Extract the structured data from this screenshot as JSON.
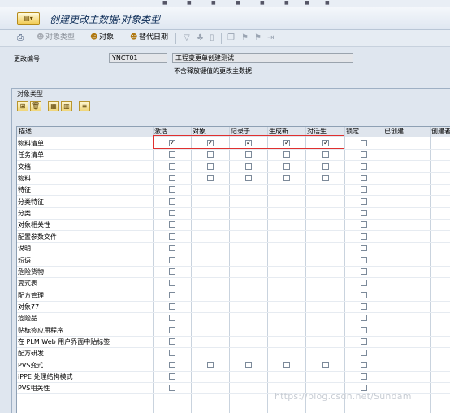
{
  "title": "创建更改主数据:对象类型",
  "title_menu_icon": "menu-icon",
  "toolbar": {
    "object_type": "对象类型",
    "object": "对象",
    "alt_date": "替代日期"
  },
  "header": {
    "change_number_label": "更改编号",
    "change_number_value": "YNCT01",
    "description": "工程变更单创建测试",
    "note": "不含释放键值的更改主数据"
  },
  "group": {
    "title": "对象类型"
  },
  "table": {
    "columns": [
      "描述",
      "激活",
      "对象",
      "记录于",
      "生成新",
      "对话生",
      "锁定",
      "已创建",
      "创建者"
    ],
    "rows": [
      {
        "label": "物料清单",
        "checks": [
          true,
          true,
          true,
          true,
          true
        ],
        "boxes": [
          true,
          true,
          true,
          true,
          true,
          true
        ]
      },
      {
        "label": "任务清单",
        "checks": [
          false,
          false,
          false,
          false,
          false
        ],
        "boxes": [
          true,
          true,
          true,
          true,
          true,
          true
        ]
      },
      {
        "label": "文档",
        "checks": [
          false,
          false,
          false,
          false,
          false
        ],
        "boxes": [
          true,
          true,
          true,
          true,
          true,
          true
        ]
      },
      {
        "label": "物料",
        "checks": [
          false,
          false,
          false,
          false,
          false
        ],
        "boxes": [
          true,
          true,
          true,
          true,
          true,
          true
        ]
      },
      {
        "label": "特征",
        "checks": [
          false,
          false,
          false,
          false,
          false
        ],
        "boxes": [
          true,
          false,
          false,
          false,
          false,
          true
        ]
      },
      {
        "label": "分类特征",
        "checks": [
          false,
          false,
          false,
          false,
          false
        ],
        "boxes": [
          true,
          false,
          false,
          false,
          false,
          true
        ]
      },
      {
        "label": "分类",
        "checks": [
          false,
          false,
          false,
          false,
          false
        ],
        "boxes": [
          true,
          false,
          false,
          false,
          false,
          true
        ]
      },
      {
        "label": "对象相关性",
        "checks": [
          false,
          false,
          false,
          false,
          false
        ],
        "boxes": [
          true,
          false,
          false,
          false,
          false,
          true
        ]
      },
      {
        "label": "配置参数文件",
        "checks": [
          false,
          false,
          false,
          false,
          false
        ],
        "boxes": [
          true,
          false,
          false,
          false,
          false,
          true
        ]
      },
      {
        "label": "说明",
        "checks": [
          false,
          false,
          false,
          false,
          false
        ],
        "boxes": [
          true,
          false,
          false,
          false,
          false,
          true
        ]
      },
      {
        "label": "短语",
        "checks": [
          false,
          false,
          false,
          false,
          false
        ],
        "boxes": [
          true,
          false,
          false,
          false,
          false,
          true
        ]
      },
      {
        "label": "危险货物",
        "checks": [
          false,
          false,
          false,
          false,
          false
        ],
        "boxes": [
          true,
          false,
          false,
          false,
          false,
          true
        ]
      },
      {
        "label": "变式表",
        "checks": [
          false,
          false,
          false,
          false,
          false
        ],
        "boxes": [
          true,
          false,
          false,
          false,
          false,
          true
        ]
      },
      {
        "label": "配方管理",
        "checks": [
          false,
          false,
          false,
          false,
          false
        ],
        "boxes": [
          true,
          false,
          false,
          false,
          false,
          true
        ]
      },
      {
        "label": "对象77",
        "checks": [
          false,
          false,
          false,
          false,
          false
        ],
        "boxes": [
          true,
          false,
          false,
          false,
          false,
          true
        ]
      },
      {
        "label": "危险品",
        "checks": [
          false,
          false,
          false,
          false,
          false
        ],
        "boxes": [
          true,
          false,
          false,
          false,
          false,
          true
        ]
      },
      {
        "label": "贴标签应用程序",
        "checks": [
          false,
          false,
          false,
          false,
          false
        ],
        "boxes": [
          true,
          false,
          false,
          false,
          false,
          true
        ]
      },
      {
        "label": "在 PLM Web 用户界面中贴标签",
        "checks": [
          false,
          false,
          false,
          false,
          false
        ],
        "boxes": [
          true,
          false,
          false,
          false,
          false,
          true
        ]
      },
      {
        "label": "配方研发",
        "checks": [
          false,
          false,
          false,
          false,
          false
        ],
        "boxes": [
          true,
          false,
          false,
          false,
          false,
          true
        ]
      },
      {
        "label": "PVS变式",
        "checks": [
          false,
          false,
          false,
          false,
          false
        ],
        "boxes": [
          true,
          true,
          true,
          true,
          true,
          true
        ]
      },
      {
        "label": "iPPE 处理结构模式",
        "checks": [
          false,
          false,
          false,
          false,
          false
        ],
        "boxes": [
          true,
          false,
          false,
          false,
          false,
          true
        ]
      },
      {
        "label": "PVS相关性",
        "checks": [
          false,
          false,
          false,
          false,
          false
        ],
        "boxes": [
          true,
          false,
          false,
          false,
          false,
          true
        ]
      }
    ]
  },
  "watermark": "https://blog.csdn.net/Sundam"
}
